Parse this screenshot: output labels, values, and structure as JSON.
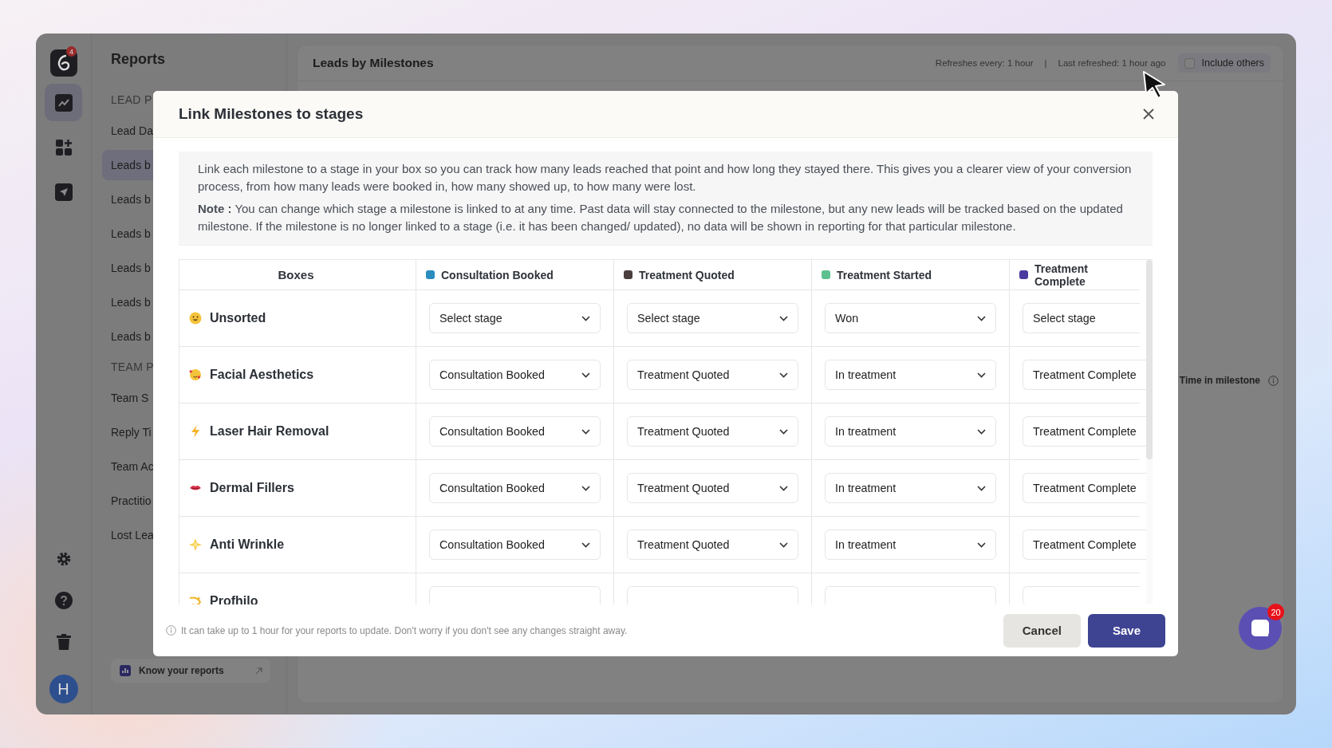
{
  "rail": {
    "logo_badge": "4",
    "items": [
      {
        "selected": true
      },
      {
        "selected": false
      },
      {
        "selected": false
      }
    ],
    "avatar": "H"
  },
  "sidebar": {
    "title": "Reports",
    "sections": [
      {
        "heading": "LEAD P",
        "items": [
          {
            "label": "Lead Da",
            "selected": false
          },
          {
            "label": "Leads b",
            "selected": true
          },
          {
            "label": "Leads b",
            "selected": false
          },
          {
            "label": "Leads b",
            "selected": false
          },
          {
            "label": "Leads b",
            "selected": false
          },
          {
            "label": "Leads b",
            "selected": false
          },
          {
            "label": "Leads b",
            "selected": false
          }
        ]
      },
      {
        "heading": "TEAM P",
        "items": [
          {
            "label": "Team S",
            "selected": false
          },
          {
            "label": "Reply Ti",
            "selected": false
          },
          {
            "label": "Team Ac",
            "selected": false
          },
          {
            "label": "Practitio",
            "selected": false
          },
          {
            "label": "Lost Lea",
            "selected": false
          }
        ]
      }
    ],
    "footer_link": "Know your reports"
  },
  "panel": {
    "title": "Leads by Milestones",
    "refresh_interval": "Refreshes every: 1 hour",
    "separator": "|",
    "last_refreshed": "Last refreshed: 1 hour ago",
    "include_others": {
      "label": "Include others",
      "checked": false
    },
    "column_label": "Time in milestone"
  },
  "modal": {
    "title": "Link Milestones to stages",
    "intro": "Link each milestone to a stage in your box so you can track how many leads reached that point and how long they stayed there. This gives you a clearer view of your conversion process, from how many leads were booked in, how many showed up, to how many were lost.",
    "note": "**Note :** You can change which stage a milestone is linked to at any time. Past data will stay connected to the milestone, but any new leads will be tracked based on the updated milestone. If the milestone is no longer linked to a stage (i.e. it has been changed/ updated), no data will be shown in reporting for that particular milestone.",
    "table": {
      "columns": [
        {
          "label": "Boxes"
        },
        {
          "label": "Consultation Booked",
          "color": "#2b8cbe"
        },
        {
          "label": "Treatment Quoted",
          "color": "#4a3e3e"
        },
        {
          "label": "Treatment Started",
          "color": "#5cc18e"
        },
        {
          "label": "Treatment Complete",
          "color": "#4a3aa0"
        }
      ],
      "rows": [
        {
          "name": "Unsorted",
          "stages": [
            "Select stage",
            "Select stage",
            "Won",
            "Select stage"
          ]
        },
        {
          "name": "Facial Aesthetics",
          "stages": [
            "Consultation Booked",
            "Treatment Quoted",
            "In treatment",
            "Treatment Complete"
          ]
        },
        {
          "name": "Laser Hair Removal",
          "stages": [
            "Consultation Booked",
            "Treatment Quoted",
            "In treatment",
            "Treatment Complete"
          ]
        },
        {
          "name": "Dermal Fillers",
          "stages": [
            "Consultation Booked",
            "Treatment Quoted",
            "In treatment",
            "Treatment Complete"
          ]
        },
        {
          "name": "Anti Wrinkle",
          "stages": [
            "Consultation Booked",
            "Treatment Quoted",
            "In treatment",
            "Treatment Complete"
          ]
        },
        {
          "name": "Profhilo"
        }
      ]
    },
    "footer_note": "It can take up to 1 hour for your reports to update. Don't worry if you don't see any changes straight away.",
    "buttons": [
      {
        "label": "Cancel",
        "kind": "secondary"
      },
      {
        "label": "Save",
        "kind": "primary"
      }
    ]
  },
  "chat": {
    "badge": "20"
  }
}
